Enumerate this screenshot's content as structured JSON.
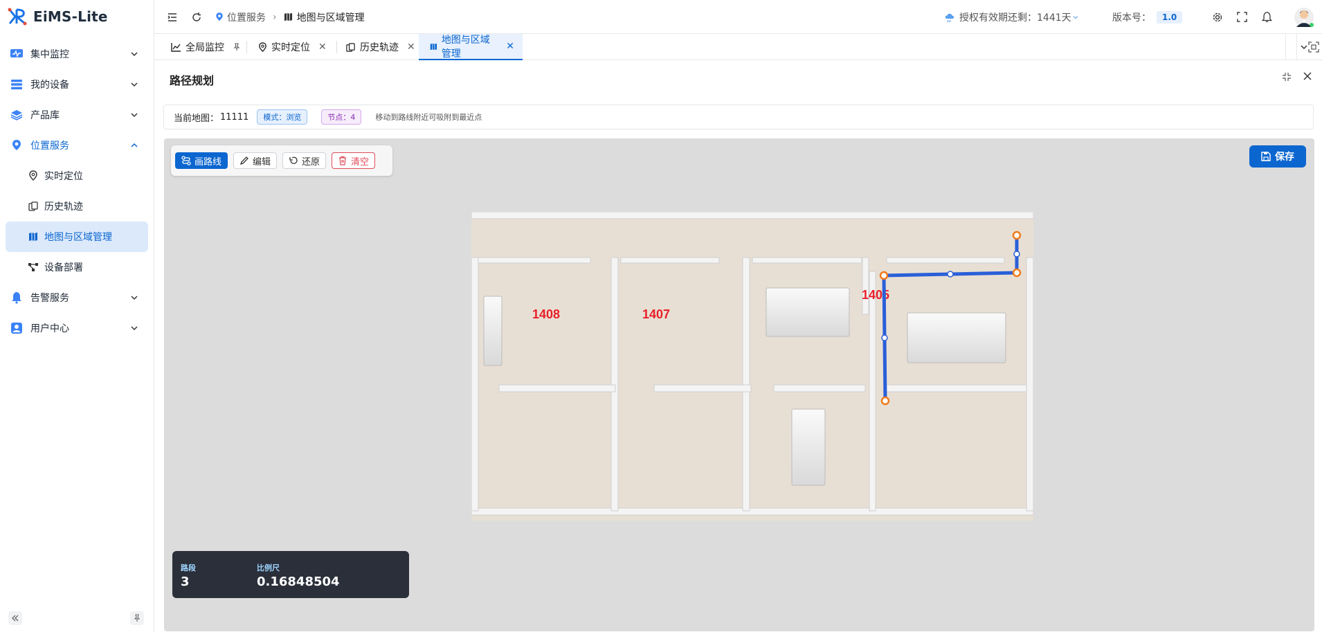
{
  "app": {
    "name": "EiMS-Lite"
  },
  "sidebar": {
    "items": [
      {
        "label": "集中监控",
        "icon": "monitor-icon"
      },
      {
        "label": "我的设备",
        "icon": "device-list-icon"
      },
      {
        "label": "产品库",
        "icon": "layers-icon"
      },
      {
        "label": "位置服务",
        "icon": "location-service-icon"
      },
      {
        "label": "告警服务",
        "icon": "bell-icon"
      },
      {
        "label": "用户中心",
        "icon": "user-center-icon"
      }
    ],
    "sub_items": [
      {
        "label": "实时定位",
        "icon": "pin-icon"
      },
      {
        "label": "历史轨迹",
        "icon": "history-icon"
      },
      {
        "label": "地图与区域管理",
        "icon": "map-icon"
      },
      {
        "label": "设备部署",
        "icon": "deploy-icon"
      }
    ]
  },
  "header": {
    "breadcrumb": [
      "位置服务",
      "地图与区域管理"
    ],
    "license_text": "授权有效期还剩：1441天",
    "version_label": "版本号：",
    "version_value": "1.0"
  },
  "tabs": [
    {
      "label": "全局监控",
      "icon": "chart-icon"
    },
    {
      "label": "实时定位",
      "icon": "pin-icon"
    },
    {
      "label": "历史轨迹",
      "icon": "history-icon"
    },
    {
      "label": "地图与区域管理",
      "icon": "map-icon"
    }
  ],
  "page": {
    "title": "路径规划",
    "current_map_label": "当前地图：",
    "current_map_value": "11111",
    "mode_pill": "模式：浏览",
    "nodes_pill": "节点：4",
    "hint": "移动到路线附近可吸附到最近点"
  },
  "toolbar": {
    "draw": "画路线",
    "edit": "编辑",
    "restore": "还原",
    "clear": "清空",
    "save": "保存"
  },
  "map": {
    "rooms": [
      "1408",
      "1407",
      "1405"
    ],
    "route_color": "#2a5fd8",
    "node_color": "#f07a1a"
  },
  "stats": {
    "segments_label": "路段",
    "segments_value": "3",
    "scale_label": "比例尺",
    "scale_value": "0.16848504"
  },
  "colors": {
    "accent": "#0b66d0",
    "danger": "#e04a5a",
    "room_label": "#e8202a"
  }
}
